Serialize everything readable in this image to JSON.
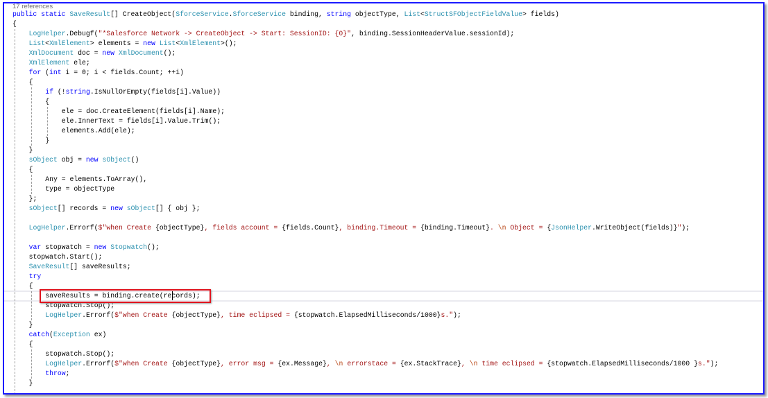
{
  "editor": {
    "references": "17 references",
    "highlight_color": "#e0141e",
    "caret_line": 29,
    "caret_col": 31,
    "lines": [
      {
        "i": 0,
        "t": [
          [
            "kw",
            "public static "
          ],
          [
            "ty",
            "SaveResult"
          ],
          [
            "pl",
            "[] CreateObject("
          ],
          [
            "ty",
            "SforceService"
          ],
          [
            "pl",
            "."
          ],
          [
            "ty",
            "SforceService"
          ],
          [
            "pl",
            " binding, "
          ],
          [
            "kw",
            "string"
          ],
          [
            "pl",
            " objectType, "
          ],
          [
            "ty",
            "List"
          ],
          [
            "pl",
            "<"
          ],
          [
            "ty",
            "StructSFObjectFieldValue"
          ],
          [
            "pl",
            "> fields)"
          ]
        ]
      },
      {
        "i": 0,
        "t": [
          [
            "pl",
            "{"
          ]
        ]
      },
      {
        "i": 1,
        "t": [
          [
            "ty",
            "LogHelper"
          ],
          [
            "pl",
            ".Debugf("
          ],
          [
            "st",
            "\"*Salesforce Network -> CreateObject -> Start: SessionID: {0}\""
          ],
          [
            "pl",
            ", binding.SessionHeaderValue.sessionId);"
          ]
        ]
      },
      {
        "i": 1,
        "t": [
          [
            "ty",
            "List"
          ],
          [
            "pl",
            "<"
          ],
          [
            "ty",
            "XmlElement"
          ],
          [
            "pl",
            "> elements = "
          ],
          [
            "kw",
            "new "
          ],
          [
            "ty",
            "List"
          ],
          [
            "pl",
            "<"
          ],
          [
            "ty",
            "XmlElement"
          ],
          [
            "pl",
            ">();"
          ]
        ]
      },
      {
        "i": 1,
        "t": [
          [
            "ty",
            "XmlDocument"
          ],
          [
            "pl",
            " doc = "
          ],
          [
            "kw",
            "new "
          ],
          [
            "ty",
            "XmlDocument"
          ],
          [
            "pl",
            "();"
          ]
        ]
      },
      {
        "i": 1,
        "t": [
          [
            "ty",
            "XmlElement"
          ],
          [
            "pl",
            " ele;"
          ]
        ]
      },
      {
        "i": 1,
        "t": [
          [
            "kw",
            "for"
          ],
          [
            "pl",
            " ("
          ],
          [
            "kw",
            "int"
          ],
          [
            "pl",
            " i = 0; i < fields.Count; ++i)"
          ]
        ]
      },
      {
        "i": 1,
        "t": [
          [
            "pl",
            "{"
          ]
        ]
      },
      {
        "i": 2,
        "t": [
          [
            "kw",
            "if"
          ],
          [
            "pl",
            " (!"
          ],
          [
            "kw",
            "string"
          ],
          [
            "pl",
            ".IsNullOrEmpty(fields[i].Value))"
          ]
        ]
      },
      {
        "i": 2,
        "t": [
          [
            "pl",
            "{"
          ]
        ]
      },
      {
        "i": 3,
        "t": [
          [
            "pl",
            "ele = doc.CreateElement(fields[i].Name);"
          ]
        ]
      },
      {
        "i": 3,
        "t": [
          [
            "pl",
            "ele.InnerText = fields[i].Value.Trim();"
          ]
        ]
      },
      {
        "i": 3,
        "t": [
          [
            "pl",
            "elements.Add(ele);"
          ]
        ]
      },
      {
        "i": 2,
        "t": [
          [
            "pl",
            "}"
          ]
        ]
      },
      {
        "i": 1,
        "t": [
          [
            "pl",
            "}"
          ]
        ]
      },
      {
        "i": 1,
        "t": [
          [
            "ty",
            "sObject"
          ],
          [
            "pl",
            " obj = "
          ],
          [
            "kw",
            "new "
          ],
          [
            "ty",
            "sObject"
          ],
          [
            "pl",
            "()"
          ]
        ]
      },
      {
        "i": 1,
        "t": [
          [
            "pl",
            "{"
          ]
        ]
      },
      {
        "i": 2,
        "t": [
          [
            "pl",
            "Any = elements.ToArray(),"
          ]
        ]
      },
      {
        "i": 2,
        "t": [
          [
            "pl",
            "type = objectType"
          ]
        ]
      },
      {
        "i": 1,
        "t": [
          [
            "pl",
            "};"
          ]
        ]
      },
      {
        "i": 1,
        "t": [
          [
            "ty",
            "sObject"
          ],
          [
            "pl",
            "[] records = "
          ],
          [
            "kw",
            "new "
          ],
          [
            "ty",
            "sObject"
          ],
          [
            "pl",
            "[] { obj };"
          ]
        ]
      },
      {
        "i": 1,
        "t": []
      },
      {
        "i": 1,
        "t": [
          [
            "ty",
            "LogHelper"
          ],
          [
            "pl",
            ".Errorf("
          ],
          [
            "st",
            "$\"when Create "
          ],
          [
            "pl",
            "{objectType}"
          ],
          [
            "st",
            ", fields account = "
          ],
          [
            "pl",
            "{fields.Count}"
          ],
          [
            "st",
            ", binding.Timeout = "
          ],
          [
            "pl",
            "{binding.Timeout}"
          ],
          [
            "st",
            ". "
          ],
          [
            "es",
            "\\n"
          ],
          [
            "st",
            " Object = "
          ],
          [
            "pl",
            "{"
          ],
          [
            "ty",
            "JsonHelper"
          ],
          [
            "pl",
            ".WriteObject(fields)}"
          ],
          [
            "st",
            "\""
          ],
          [
            "pl",
            ");"
          ]
        ]
      },
      {
        "i": 1,
        "t": []
      },
      {
        "i": 1,
        "t": [
          [
            "kw",
            "var"
          ],
          [
            "pl",
            " stopwatch = "
          ],
          [
            "kw",
            "new "
          ],
          [
            "ty",
            "Stopwatch"
          ],
          [
            "pl",
            "();"
          ]
        ]
      },
      {
        "i": 1,
        "t": [
          [
            "pl",
            "stopwatch.Start();"
          ]
        ]
      },
      {
        "i": 1,
        "t": [
          [
            "ty",
            "SaveResult"
          ],
          [
            "pl",
            "[] saveResults;"
          ]
        ]
      },
      {
        "i": 1,
        "t": [
          [
            "kw",
            "try"
          ]
        ]
      },
      {
        "i": 1,
        "t": [
          [
            "pl",
            "{"
          ]
        ]
      },
      {
        "i": 2,
        "t": [
          [
            "pl",
            "saveResults = binding.create(records);"
          ]
        ]
      },
      {
        "i": 2,
        "t": [
          [
            "pl",
            "stopwatch.Stop();"
          ]
        ]
      },
      {
        "i": 2,
        "t": [
          [
            "ty",
            "LogHelper"
          ],
          [
            "pl",
            ".Errorf("
          ],
          [
            "st",
            "$\"when Create "
          ],
          [
            "pl",
            "{objectType}"
          ],
          [
            "st",
            ", time eclipsed = "
          ],
          [
            "pl",
            "{stopwatch.ElapsedMilliseconds/1000}"
          ],
          [
            "st",
            "s.\""
          ],
          [
            "pl",
            ");"
          ]
        ]
      },
      {
        "i": 1,
        "t": [
          [
            "pl",
            "}"
          ]
        ]
      },
      {
        "i": 1,
        "t": [
          [
            "kw",
            "catch"
          ],
          [
            "pl",
            "("
          ],
          [
            "ty",
            "Exception"
          ],
          [
            "pl",
            " ex)"
          ]
        ]
      },
      {
        "i": 1,
        "t": [
          [
            "pl",
            "{"
          ]
        ]
      },
      {
        "i": 2,
        "t": [
          [
            "pl",
            "stopwatch.Stop();"
          ]
        ]
      },
      {
        "i": 2,
        "t": [
          [
            "ty",
            "LogHelper"
          ],
          [
            "pl",
            ".Errorf("
          ],
          [
            "st",
            "$\"when Create "
          ],
          [
            "pl",
            "{objectType}"
          ],
          [
            "st",
            ", error msg = "
          ],
          [
            "pl",
            "{ex.Message}"
          ],
          [
            "st",
            ", "
          ],
          [
            "es",
            "\\n"
          ],
          [
            "st",
            " errorstace = "
          ],
          [
            "pl",
            "{ex.StackTrace}"
          ],
          [
            "st",
            ", "
          ],
          [
            "es",
            "\\n"
          ],
          [
            "st",
            " time eclipsed = "
          ],
          [
            "pl",
            "{stopwatch.ElapsedMilliseconds/1000 }"
          ],
          [
            "st",
            "s.\""
          ],
          [
            "pl",
            ");"
          ]
        ]
      },
      {
        "i": 2,
        "t": [
          [
            "kw",
            "throw"
          ],
          [
            "pl",
            ";"
          ]
        ]
      },
      {
        "i": 1,
        "t": [
          [
            "pl",
            "}"
          ]
        ]
      }
    ]
  }
}
